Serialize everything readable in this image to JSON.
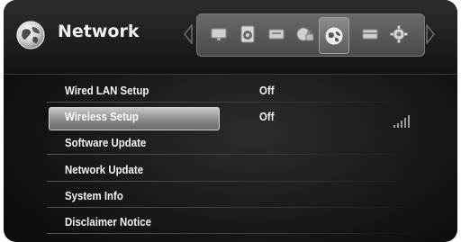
{
  "header": {
    "title": "Network",
    "icons": [
      "display-icon",
      "audio-icon",
      "language-icon",
      "lock-icon",
      "network-icon",
      "media-icon",
      "settings-icon"
    ],
    "selected_icon": "network-icon"
  },
  "menu": {
    "items": [
      {
        "label": "Wired LAN Setup",
        "value": "Off",
        "selected": false
      },
      {
        "label": "Wireless Setup",
        "value": "Off",
        "selected": true
      },
      {
        "label": "Software Update",
        "value": "",
        "selected": false
      },
      {
        "label": "Network Update",
        "value": "",
        "selected": false
      },
      {
        "label": "System Info",
        "value": "",
        "selected": false
      },
      {
        "label": "Disclaimer Notice",
        "value": "",
        "selected": false
      }
    ]
  },
  "status": {
    "wifi_signal_icon": "wifi-signal-icon"
  }
}
